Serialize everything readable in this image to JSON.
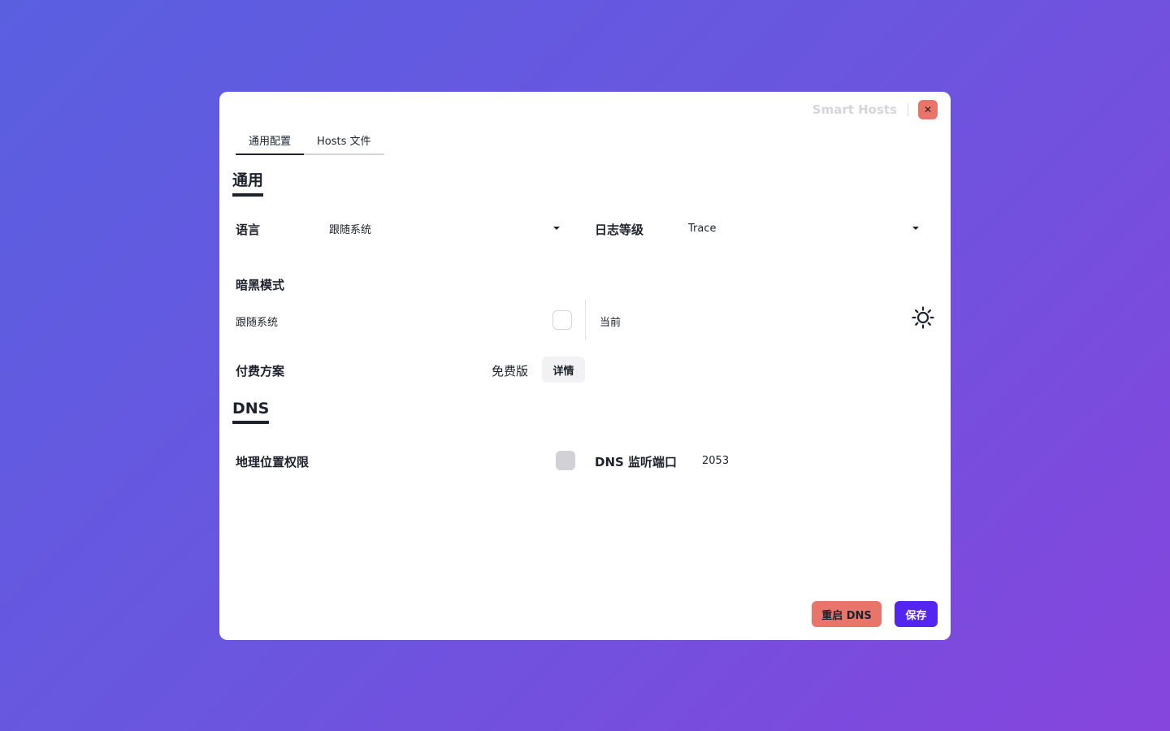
{
  "header": {
    "app_title": "Smart Hosts",
    "close_label": "✕"
  },
  "tabs": [
    {
      "label": "通用配置",
      "active": true
    },
    {
      "label": "Hosts 文件",
      "active": false
    }
  ],
  "general": {
    "section_title": "通用",
    "language": {
      "label": "语言",
      "value": "跟随系统"
    },
    "log_level": {
      "label": "日志等级",
      "value": "Trace"
    },
    "dark_mode": {
      "label": "暗黑模式",
      "follow_system_label": "跟随系统",
      "follow_system_checked": false,
      "current_label": "当前",
      "current_icon": "sun-icon"
    },
    "plan": {
      "label": "付费方案",
      "value": "免费版",
      "details_button": "详情"
    }
  },
  "dns": {
    "section_title": "DNS",
    "geo_permission": {
      "label": "地理位置权限",
      "checked": false
    },
    "listen_port": {
      "label": "DNS 监听端口",
      "value": "2053"
    }
  },
  "footer": {
    "restart_dns_button": "重启 DNS",
    "save_button": "保存"
  },
  "colors": {
    "accent": "#5424f0",
    "danger": "#e9756a"
  }
}
